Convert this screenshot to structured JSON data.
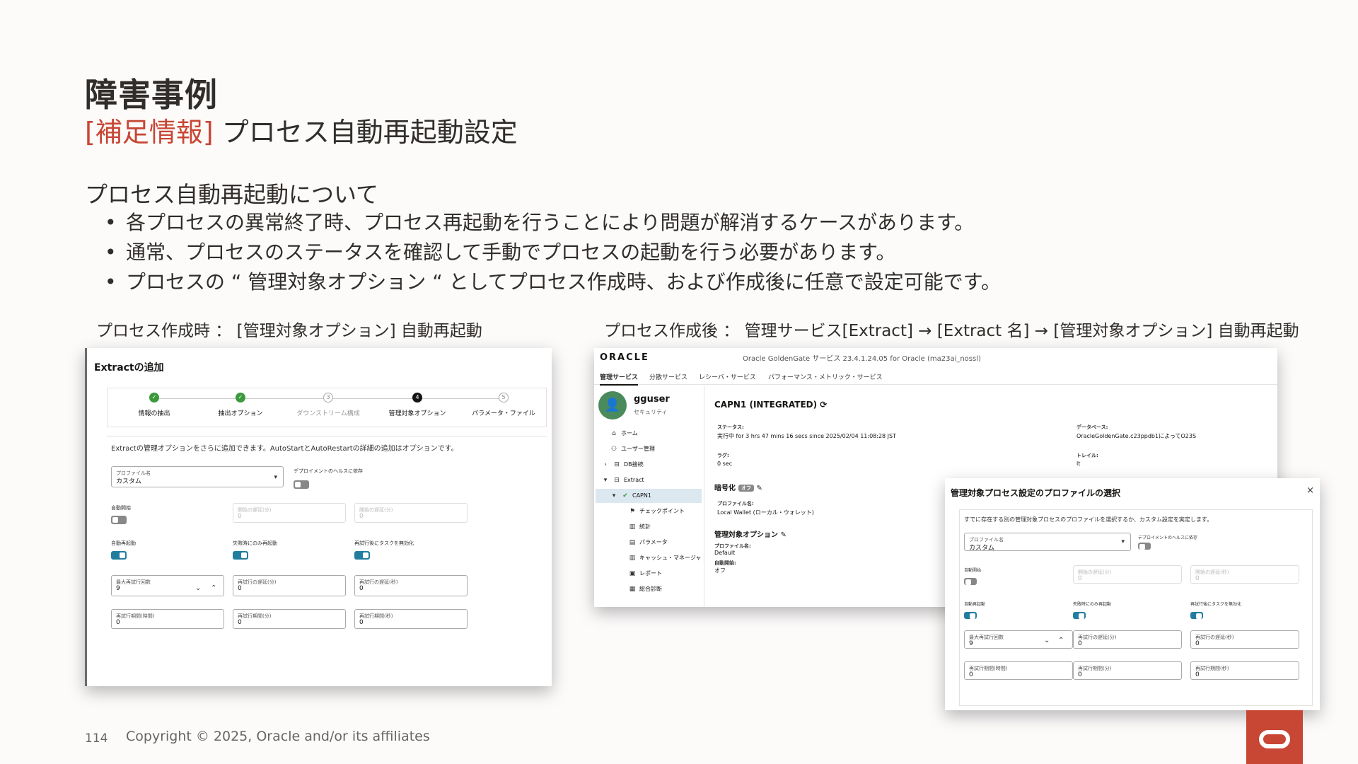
{
  "slide": {
    "title": "障害事例",
    "subtitle_accent": "[補足情報]",
    "subtitle_rest": " プロセス自動再起動設定",
    "section_heading": "プロセス自動再起動について",
    "bullets": [
      "各プロセスの異常終了時、プロセス再起動を行うことにより問題が解消するケースがあります。",
      "通常、プロセスのステータスを確認して手動でプロセスの起動を行う必要があります。",
      "プロセスの “ 管理対象オプション “ としてプロセス作成時、および作成後に任意で設定可能です。"
    ],
    "caption_left": "プロセス作成時 ： [管理対象オプション] 自動再起動",
    "caption_right": "プロセス作成後 ： 管理サービス[Extract] → [Extract 名] → [管理対象オプション] 自動再起動",
    "page_number": "114",
    "copyright": "Copyright © 2025, Oracle and/or its affiliates",
    "accent_color": "#c74634"
  },
  "wizard": {
    "title": "Extractの追加",
    "steps": [
      {
        "num": "✓",
        "label": "情報の抽出",
        "state": "done"
      },
      {
        "num": "✓",
        "label": "抽出オプション",
        "state": "done"
      },
      {
        "num": "3",
        "label": "ダウンストリーム構成",
        "state": "todo"
      },
      {
        "num": "4",
        "label": "管理対象オプション",
        "state": "current"
      },
      {
        "num": "5",
        "label": "パラメータ・ファイル",
        "state": "todo"
      }
    ],
    "description": "Extractの管理オプションをさらに追加できます。AutoStartとAutoRestartの詳細の追加はオプションです。",
    "profile_label": "プロファイル名",
    "profile_value": "カスタム",
    "deploy_health_label": "デプロイメントのヘルスに依存",
    "auto_start_label": "自動開始",
    "start_delay_label_1": "開始の遅延(分)",
    "start_delay_value_1": "0",
    "start_delay_label_2": "開始の遅延(分)",
    "start_delay_value_2": "0",
    "auto_restart_label": "自動再起動",
    "restart_failure_only_label": "失敗時にのみ再起動",
    "disable_task_label": "再試行後にタスクを無効化",
    "max_retries_label": "最大再試行回数",
    "max_retries_value": "9",
    "retry_delay_label_1": "再試行の遅延(分)",
    "retry_delay_value_1": "0",
    "retry_delay_label_2": "再試行の遅延(秒)",
    "retry_delay_value_2": "0",
    "retry_window_label_1": "再試行期間(時間)",
    "retry_window_value_1": "0",
    "retry_window_label_2": "再試行期間(分)",
    "retry_window_value_2": "0",
    "retry_window_label_3": "再試行期間(秒)",
    "retry_window_value_3": "0"
  },
  "console": {
    "logo": "ORACLE",
    "service_title": "Oracle GoldenGate サービス 23.4.1.24.05 for Oracle (ma23ai_nossl)",
    "tabs": [
      "管理サービス",
      "分散サービス",
      "レシーバ・サービス",
      "パフォーマンス・メトリック・サービス"
    ],
    "user": {
      "initial": "👤",
      "name": "gguser",
      "role": "セキュリティ"
    },
    "nav": [
      {
        "icon": "⌂",
        "label": "ホーム"
      },
      {
        "icon": "⚇",
        "label": "ユーザー管理"
      },
      {
        "icon": "⊟",
        "label": "DB接続"
      },
      {
        "icon": "⊟",
        "label": "Extract"
      },
      {
        "icon": "✔",
        "label": "CAPN1"
      },
      {
        "icon": "⚑",
        "label": "チェックポイント"
      },
      {
        "icon": "▥",
        "label": "統計"
      },
      {
        "icon": "▤",
        "label": "パラメータ"
      },
      {
        "icon": "▥",
        "label": "キャッシュ・マネージャ"
      },
      {
        "icon": "▣",
        "label": "レポート"
      },
      {
        "icon": "▦",
        "label": "総合診断"
      }
    ],
    "process_title": "CAPN1 (INTEGRATED) ⟳",
    "status_key": "ステータス:",
    "status_value": "実行中 for 3 hrs 47 mins 16 secs since 2025/02/04 11:08:28 JST",
    "db_key": "データベース:",
    "db_value": "OracleGoldenGate.c23ppdb1によってO23S",
    "lag_key": "ラグ:",
    "lag_value": "0 sec",
    "trail_key": "トレイル:",
    "trail_value": "lt",
    "encryption_heading": "暗号化",
    "encryption_badge": "オフ",
    "profile_key": "プロファイル名:",
    "profile_value": "Local Wallet (ローカル・ウォレット)",
    "managed_heading": "管理対象オプション",
    "managed_profile_key": "プロファイル名:",
    "managed_profile_value": "Default",
    "auto_start_key": "自動開始:",
    "auto_start_value": "オフ"
  },
  "dialog": {
    "title": "管理対象プロセス設定のプロファイルの選択",
    "close": "×",
    "description": "すでに存在する別の管理対象プロセスのプロファイルを選択するか、カスタム設定を実定します。",
    "profile_label": "プロファイル名",
    "profile_value": "カスタム",
    "deploy_health_label": "デプロイメントのヘルスに依存",
    "auto_start_label": "自動開始",
    "start_delay_label_1": "開始の遅延(分)",
    "start_delay_value_1": "0",
    "start_delay_label_2": "開始の遅延(秒)",
    "start_delay_value_2": "0",
    "auto_restart_label": "自動再起動",
    "restart_failure_only_label": "失敗時にのみ再起動",
    "disable_task_label": "再試行後にタスクを無効化",
    "max_retries_label": "最大再試行回数",
    "max_retries_value": "9",
    "retry_delay_label_1": "再試行の遅延(分)",
    "retry_delay_value_1": "0",
    "retry_delay_label_2": "再試行の遅延(秒)",
    "retry_delay_value_2": "0",
    "retry_window_label_1": "再試行期間(時間)",
    "retry_window_value_1": "0",
    "retry_window_label_2": "再試行期間(分)",
    "retry_window_value_2": "0",
    "retry_window_label_3": "再試行期間(秒)",
    "retry_window_value_3": "0"
  }
}
